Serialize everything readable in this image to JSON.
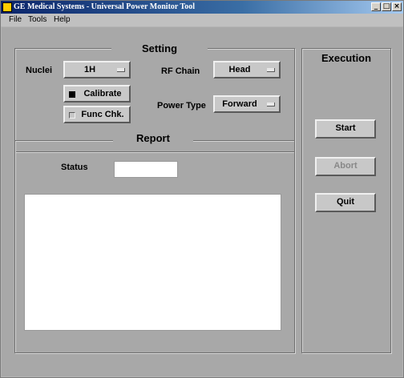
{
  "window": {
    "title": "GE Medical Systems - Universal Power Monitor Tool",
    "controls": {
      "minimize": "_",
      "maximize": "□",
      "close": "×"
    }
  },
  "menu": [
    "File",
    "Tools",
    "Help"
  ],
  "setting": {
    "title": "Setting",
    "nuclei_label": "Nuclei",
    "nuclei_value": "1H",
    "rf_chain_label": "RF Chain",
    "rf_chain_value": "Head",
    "power_type_label": "Power Type",
    "power_type_value": "Forward",
    "calibrate_label": "Calibrate",
    "func_chk_label": "Func Chk."
  },
  "report": {
    "title": "Report",
    "status_label": "Status",
    "status_value": "",
    "log_text": ""
  },
  "execution": {
    "title": "Execution",
    "start_label": "Start",
    "abort_label": "Abort",
    "quit_label": "Quit"
  }
}
